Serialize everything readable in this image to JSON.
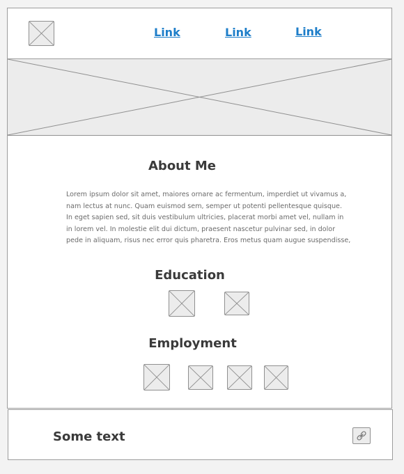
{
  "header": {
    "logo_icon": "image-placeholder-icon",
    "nav_links": [
      "Link",
      "Link",
      "Link"
    ],
    "link_color": "#1e7ec9"
  },
  "hero": {
    "icon": "image-placeholder-icon"
  },
  "about": {
    "title": "About Me",
    "text": "Lorem ipsum dolor sit amet, maiores ornare ac fermentum, imperdiet ut vivamus a,\nnam lectus at nunc. Quam euismod sem, semper ut potenti pellentesque quisque.\nIn eget sapien sed, sit duis vestibulum ultricies, placerat morbi amet vel, nullam in\nin lorem vel. In molestie elit dui dictum, praesent nascetur pulvinar sed, in dolor\npede in aliquam, risus nec error quis pharetra. Eros metus quam augue suspendisse,"
  },
  "education": {
    "title": "Education",
    "items": [
      "image-placeholder-icon",
      "image-placeholder-icon"
    ]
  },
  "employment": {
    "title": "Employment",
    "items": [
      "image-placeholder-icon",
      "image-placeholder-icon",
      "image-placeholder-icon",
      "image-placeholder-icon"
    ]
  },
  "footer": {
    "text": "Some text",
    "button_icon": "link-icon"
  }
}
